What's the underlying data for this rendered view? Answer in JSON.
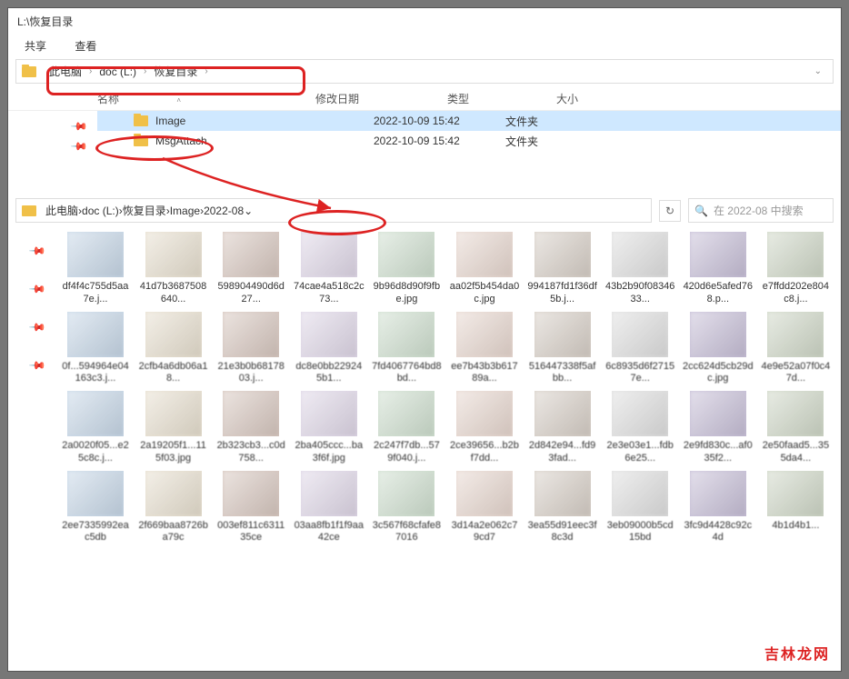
{
  "window": {
    "title": "L:\\恢复目录"
  },
  "menu": {
    "share": "共享",
    "view": "查看"
  },
  "bc1": {
    "c0": "此电脑",
    "c1": "doc (L:)",
    "c2": "恢复目录"
  },
  "list": {
    "h_name": "名称",
    "h_date": "修改日期",
    "h_type": "类型",
    "h_size": "大小",
    "rows": [
      {
        "name": "Image",
        "date": "2022-10-09 15:42",
        "type": "文件夹"
      },
      {
        "name": "MsgAttach",
        "date": "2022-10-09 15:42",
        "type": "文件夹"
      }
    ]
  },
  "bc2": {
    "c0": "此电脑",
    "c1": "doc (L:)",
    "c2": "恢复目录",
    "c3": "Image",
    "c4": "2022-08"
  },
  "search": {
    "placeholder": "在 2022-08 中搜索"
  },
  "thumbs": [
    {
      "n": "df4f4c755d5aa7e.j..."
    },
    {
      "n": "41d7b3687508640..."
    },
    {
      "n": "598904490d6d27..."
    },
    {
      "n": "74cae4a518c2c73..."
    },
    {
      "n": "9b96d8d90f9fbe.jpg"
    },
    {
      "n": "aa02f5b454da0c.jpg"
    },
    {
      "n": "994187fd1f36df5b.j..."
    },
    {
      "n": "43b2b90f0834633..."
    },
    {
      "n": "420d6e5afed768.p..."
    },
    {
      "n": "e7ffdd202e804c8.j..."
    },
    {
      "n": "0f...594964e04163c3.j..."
    },
    {
      "n": "2cfb4a6db06a18..."
    },
    {
      "n": "21e3b0b6817803.j..."
    },
    {
      "n": "dc8e0bb229245b1..."
    },
    {
      "n": "7fd4067764bd8bd..."
    },
    {
      "n": "ee7b43b3b61789a..."
    },
    {
      "n": "516447338f5afbb..."
    },
    {
      "n": "6c8935d6f27157e..."
    },
    {
      "n": "2cc624d5cb29dc.jpg"
    },
    {
      "n": "4e9e52a07f0c47d..."
    },
    {
      "n": "2a0020f05...e25c8c.j..."
    },
    {
      "n": "2a19205f1...115f03.jpg"
    },
    {
      "n": "2b323cb3...c0d758..."
    },
    {
      "n": "2ba405ccc...ba3f6f.jpg"
    },
    {
      "n": "2c247f7db...579f040.j..."
    },
    {
      "n": "2ce39656...b2bf7dd..."
    },
    {
      "n": "2d842e94...fd93fad..."
    },
    {
      "n": "2e3e03e1...fdb6e25..."
    },
    {
      "n": "2e9fd830c...af035f2..."
    },
    {
      "n": "2e50faad5...355da4..."
    },
    {
      "n": "2ee7335992eac5db"
    },
    {
      "n": "2f669baa8726ba79c"
    },
    {
      "n": "003ef811c631135ce"
    },
    {
      "n": "03aa8fb1f1f9aa42ce"
    },
    {
      "n": "3c567f68cfafe87016"
    },
    {
      "n": "3d14a2e062c79cd7"
    },
    {
      "n": "3ea55d91eec3f8c3d"
    },
    {
      "n": "3eb09000b5cd15bd"
    },
    {
      "n": "3fc9d4428c92c4d"
    },
    {
      "n": "4b1d4b1..."
    }
  ],
  "watermark": "吉林龙网"
}
